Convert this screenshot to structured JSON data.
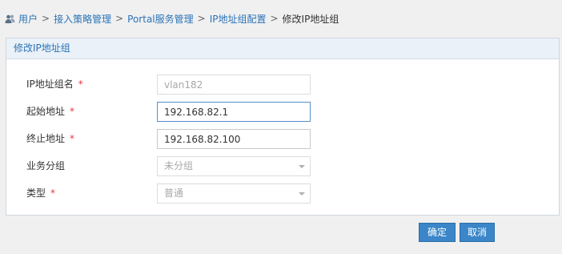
{
  "breadcrumb": {
    "items": [
      "用户",
      "接入策略管理",
      "Portal服务管理",
      "IP地址组配置"
    ],
    "current": "修改IP地址组",
    "separator": ">"
  },
  "panel": {
    "title": "修改IP地址组"
  },
  "form": {
    "required_mark": "*",
    "group_name": {
      "label": "IP地址组名",
      "value": "vlan182"
    },
    "start_address": {
      "label": "起始地址",
      "value": "192.168.82.1"
    },
    "end_address": {
      "label": "终止地址",
      "value": "192.168.82.100"
    },
    "service_group": {
      "label": "业务分组",
      "value": "未分组"
    },
    "type": {
      "label": "类型",
      "value": "普通"
    }
  },
  "buttons": {
    "confirm": "确定",
    "cancel": "取消"
  },
  "colors": {
    "accent": "#3a86c8",
    "link": "#2b73b7",
    "required": "#e8393b",
    "panel_header_bg": "#eaf1f8"
  }
}
